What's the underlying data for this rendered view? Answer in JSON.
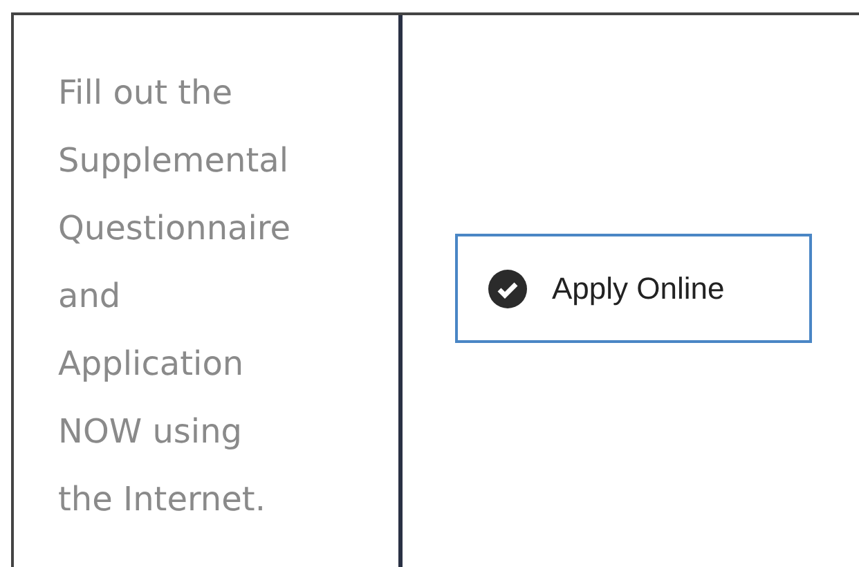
{
  "instructions": "Fill out the Supplemental Questionnaire and Application NOW using the Internet.",
  "button": {
    "label": "Apply Online"
  }
}
